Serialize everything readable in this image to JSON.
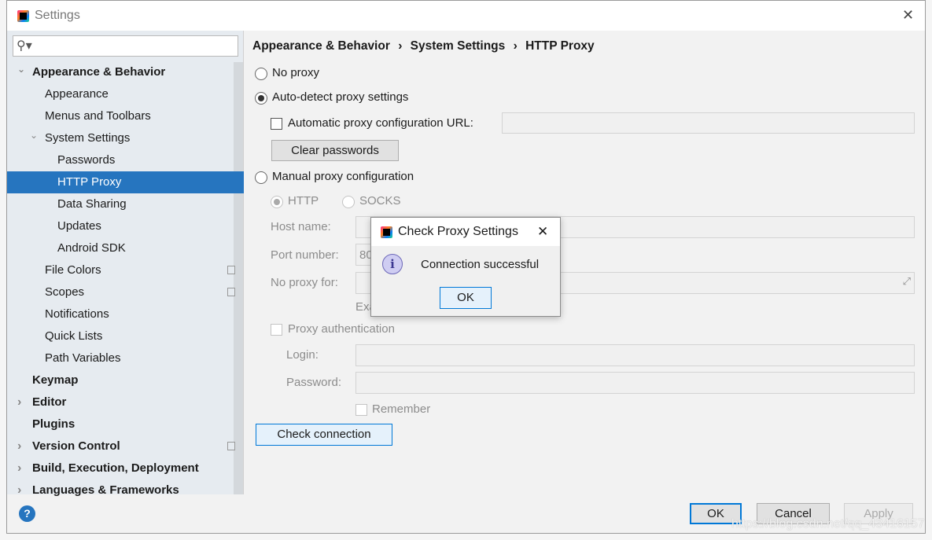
{
  "window": {
    "title": "Settings",
    "close": "✕"
  },
  "sidebar": {
    "search_placeholder": "",
    "items": [
      {
        "label": "Appearance & Behavior",
        "level": 0,
        "bold": true,
        "expanded": true
      },
      {
        "label": "Appearance",
        "level": 1
      },
      {
        "label": "Menus and Toolbars",
        "level": 1
      },
      {
        "label": "System Settings",
        "level": 1,
        "expanded": true
      },
      {
        "label": "Passwords",
        "level": 2
      },
      {
        "label": "HTTP Proxy",
        "level": 2,
        "selected": true
      },
      {
        "label": "Data Sharing",
        "level": 2
      },
      {
        "label": "Updates",
        "level": 2
      },
      {
        "label": "Android SDK",
        "level": 2
      },
      {
        "label": "File Colors",
        "level": 1,
        "copy": true
      },
      {
        "label": "Scopes",
        "level": 1,
        "copy": true
      },
      {
        "label": "Notifications",
        "level": 1
      },
      {
        "label": "Quick Lists",
        "level": 1
      },
      {
        "label": "Path Variables",
        "level": 1
      },
      {
        "label": "Keymap",
        "level": 0,
        "bold": true
      },
      {
        "label": "Editor",
        "level": 0,
        "bold": true,
        "collapsed": true
      },
      {
        "label": "Plugins",
        "level": 0,
        "bold": true
      },
      {
        "label": "Version Control",
        "level": 0,
        "bold": true,
        "collapsed": true,
        "copy": true
      },
      {
        "label": "Build, Execution, Deployment",
        "level": 0,
        "bold": true,
        "collapsed": true
      },
      {
        "label": "Languages & Frameworks",
        "level": 0,
        "bold": true,
        "collapsed": true
      }
    ]
  },
  "breadcrumb": [
    "Appearance & Behavior",
    "System Settings",
    "HTTP Proxy"
  ],
  "proxy": {
    "no_proxy": "No proxy",
    "auto_detect": "Auto-detect proxy settings",
    "auto_config_url": "Automatic proxy configuration URL:",
    "clear_passwords": "Clear passwords",
    "manual": "Manual proxy configuration",
    "http": "HTTP",
    "socks": "SOCKS",
    "host_label": "Host name:",
    "port_label": "Port number:",
    "port_value": "80",
    "no_proxy_for": "No proxy for:",
    "example": "Exa",
    "proxy_auth": "Proxy authentication",
    "login": "Login:",
    "password": "Password:",
    "remember": "Remember",
    "check_connection": "Check connection"
  },
  "dialog": {
    "title": "Check Proxy Settings",
    "message": "Connection successful",
    "ok": "OK",
    "close": "✕"
  },
  "footer": {
    "help": "?",
    "ok": "OK",
    "cancel": "Cancel",
    "apply": "Apply"
  },
  "watermark": "https://blog.csdn.net/qq_43416157"
}
